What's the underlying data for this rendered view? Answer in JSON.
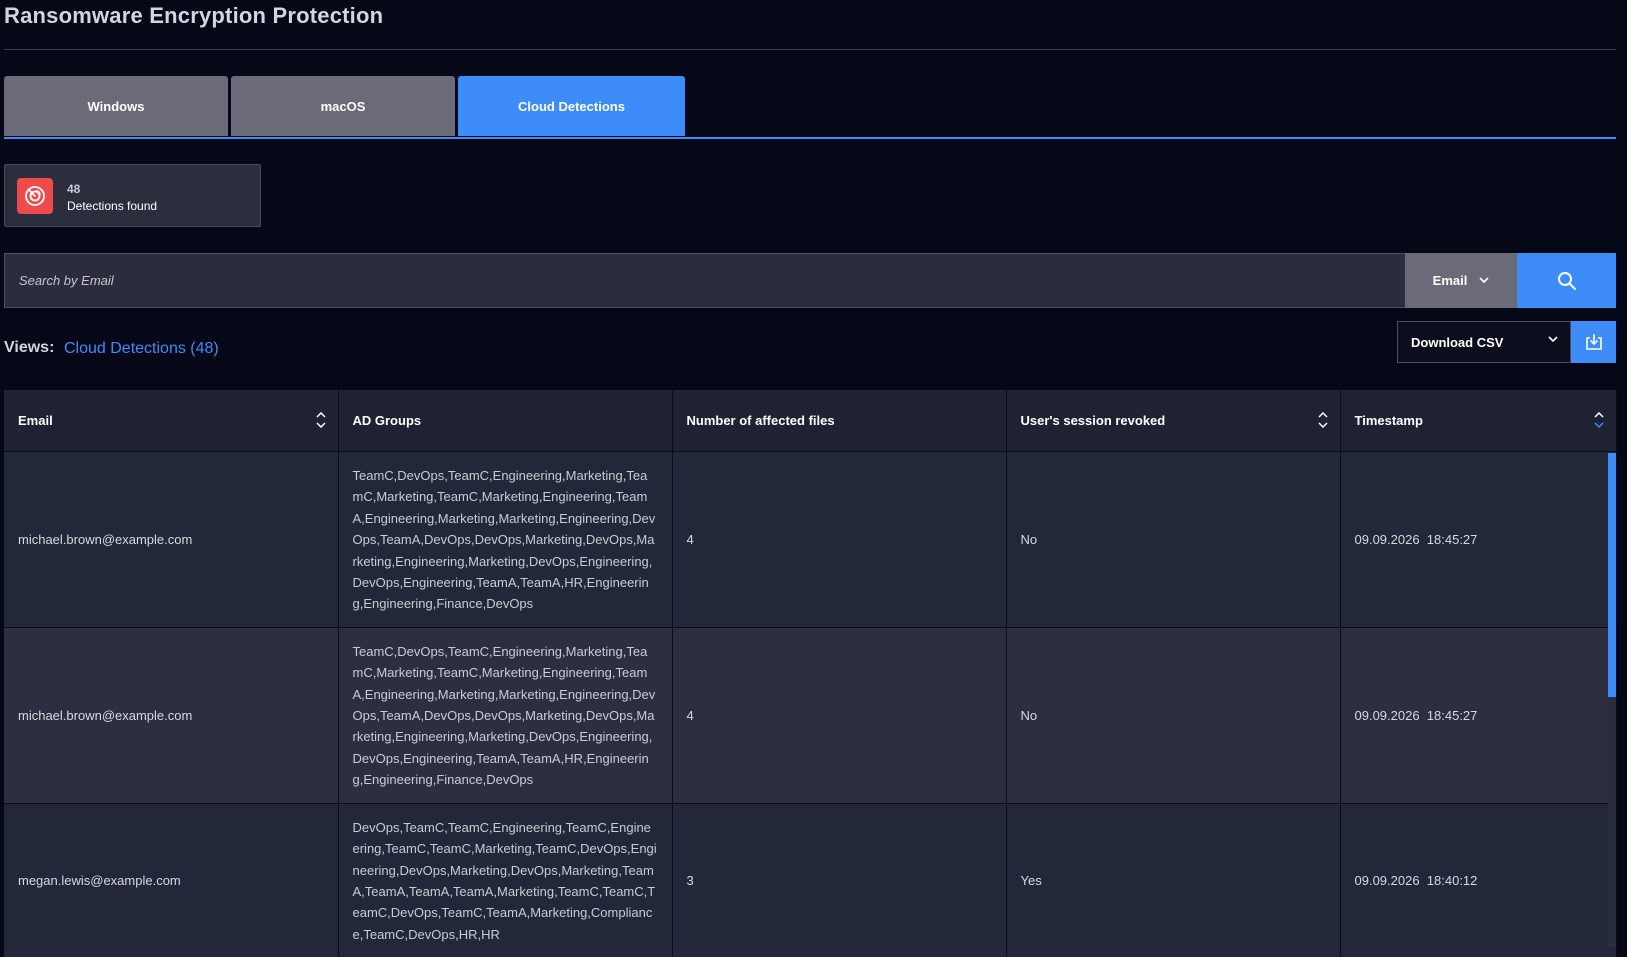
{
  "page": {
    "title": "Ransomware Encryption Protection"
  },
  "tabs": [
    {
      "label": "Windows",
      "active": false
    },
    {
      "label": "macOS",
      "active": false
    },
    {
      "label": "Cloud Detections",
      "active": true
    }
  ],
  "summary": {
    "count": "48",
    "label": "Detections found",
    "icon": "radar-alert-icon"
  },
  "search": {
    "placeholder": "Search by Email",
    "value": "",
    "field": "Email"
  },
  "views": {
    "label": "Views:",
    "current": "Cloud Detections (48)"
  },
  "download": {
    "label": "Download CSV"
  },
  "table": {
    "columns": [
      "Email",
      "AD Groups",
      "Number of affected files",
      "User's session revoked",
      "Timestamp"
    ],
    "rows": [
      {
        "email": "michael.brown@example.com",
        "groups": "TeamC,DevOps,TeamC,Engineering,Marketing,TeamC,Marketing,TeamC,Marketing,Engineering,TeamA,Engineering,Marketing,Marketing,Engineering,DevOps,TeamA,DevOps,DevOps,Marketing,DevOps,Marketing,Engineering,Marketing,DevOps,Engineering,DevOps,Engineering,TeamA,TeamA,HR,Engineering,Engineering,Finance,DevOps",
        "files": "4",
        "revoked": "No",
        "timestamp": "09.09.2026  18:45:27"
      },
      {
        "email": "michael.brown@example.com",
        "groups": "TeamC,DevOps,TeamC,Engineering,Marketing,TeamC,Marketing,TeamC,Marketing,Engineering,TeamA,Engineering,Marketing,Marketing,Engineering,DevOps,TeamA,DevOps,DevOps,Marketing,DevOps,Marketing,Engineering,Marketing,DevOps,Engineering,DevOps,Engineering,TeamA,TeamA,HR,Engineering,Engineering,Finance,DevOps",
        "files": "4",
        "revoked": "No",
        "timestamp": "09.09.2026  18:45:27"
      },
      {
        "email": "megan.lewis@example.com",
        "groups": "DevOps,TeamC,TeamC,Engineering,TeamC,Engineering,TeamC,TeamC,Marketing,TeamC,DevOps,Engineering,DevOps,Marketing,DevOps,Marketing,TeamA,TeamA,TeamA,TeamA,Marketing,TeamC,TeamC,TeamC,DevOps,TeamC,TeamA,Marketing,Compliance,TeamC,DevOps,HR,HR",
        "files": "3",
        "revoked": "Yes",
        "timestamp": "09.09.2026  18:40:12"
      }
    ]
  },
  "colors": {
    "accent": "#3d8cf7",
    "alert": "#f04b4b",
    "background": "#060818"
  }
}
